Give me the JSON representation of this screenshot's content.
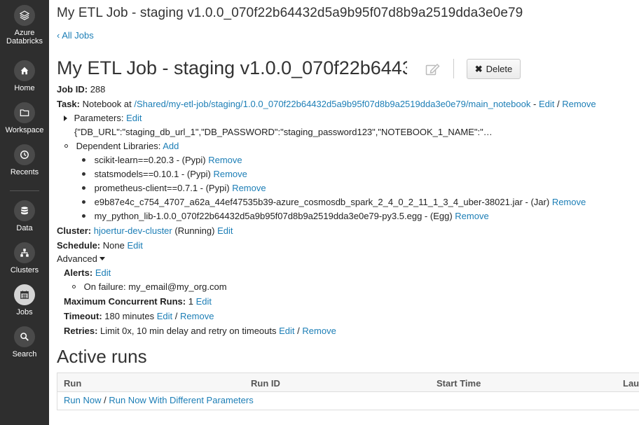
{
  "sidebar": {
    "items": [
      {
        "label_line1": "Azure",
        "label_line2": "Databricks",
        "icon": "databricks-logo-icon"
      },
      {
        "label": "Home",
        "icon": "home-icon"
      },
      {
        "label": "Workspace",
        "icon": "folder-icon"
      },
      {
        "label": "Recents",
        "icon": "clock-icon"
      },
      {
        "label": "Data",
        "icon": "database-icon"
      },
      {
        "label": "Clusters",
        "icon": "clusters-icon"
      },
      {
        "label": "Jobs",
        "icon": "calendar-icon",
        "active": true
      },
      {
        "label": "Search",
        "icon": "search-icon"
      }
    ]
  },
  "header": {
    "page_title": "My ETL Job - staging v1.0.0_070f22b64432d5a9b95f07d8b9a2519dda3e0e79",
    "back_link": "‹ All Jobs",
    "job_name": "My ETL Job - staging v1.0.0_070f22b64432d5a9b95f07d8b9a2519dda3e0e79",
    "delete_label": "Delete"
  },
  "job": {
    "id_label": "Job ID:",
    "id_value": "288",
    "task_label": "Task:",
    "task_prefix": "Notebook at",
    "task_path": "/Shared/my-etl-job/staging/1.0.0_070f22b64432d5a9b95f07d8b9a2519dda3e0e79/main_notebook",
    "task_sep": "-",
    "edit": "Edit",
    "remove": "Remove",
    "slash": "/",
    "parameters_label": "Parameters:",
    "parameters_value": "{\"DB_URL\":\"staging_db_url_1\",\"DB_PASSWORD\":\"staging_password123\",\"NOTEBOOK_1_NAME\":\"…",
    "dependent_label": "Dependent Libraries:",
    "add": "Add",
    "libraries": [
      {
        "name": "scikit-learn==0.20.3 - (Pypi)"
      },
      {
        "name": "statsmodels==0.10.1 - (Pypi)"
      },
      {
        "name": "prometheus-client==0.7.1 - (Pypi)"
      },
      {
        "name": "e9b87e4c_c754_4707_a62a_44ef47535b39-azure_cosmosdb_spark_2_4_0_2_11_1_3_4_uber-38021.jar - (Jar)"
      },
      {
        "name": "my_python_lib-1.0.0_070f22b64432d5a9b95f07d8b9a2519dda3e0e79-py3.5.egg - (Egg)"
      }
    ],
    "cluster_label": "Cluster:",
    "cluster_name": "hjoertur-dev-cluster",
    "cluster_state": "(Running)",
    "schedule_label": "Schedule:",
    "schedule_value": "None",
    "advanced_label": "Advanced",
    "alerts_label": "Alerts:",
    "on_failure": "On failure: my_email@my_org.com",
    "max_runs_label": "Maximum Concurrent Runs:",
    "max_runs_value": "1",
    "timeout_label": "Timeout:",
    "timeout_value": "180 minutes",
    "retries_label": "Retries:",
    "retries_value": "Limit 0x, 10 min delay and retry on timeouts"
  },
  "active_runs": {
    "heading": "Active runs",
    "columns": [
      "Run",
      "Run ID",
      "Start Time",
      "Lau"
    ],
    "run_now": "Run Now",
    "sep": "/",
    "run_now_params": "Run Now With Different Parameters"
  },
  "colors": {
    "sidebar_bg": "#2e2e2e",
    "link": "#1c7eb6"
  }
}
